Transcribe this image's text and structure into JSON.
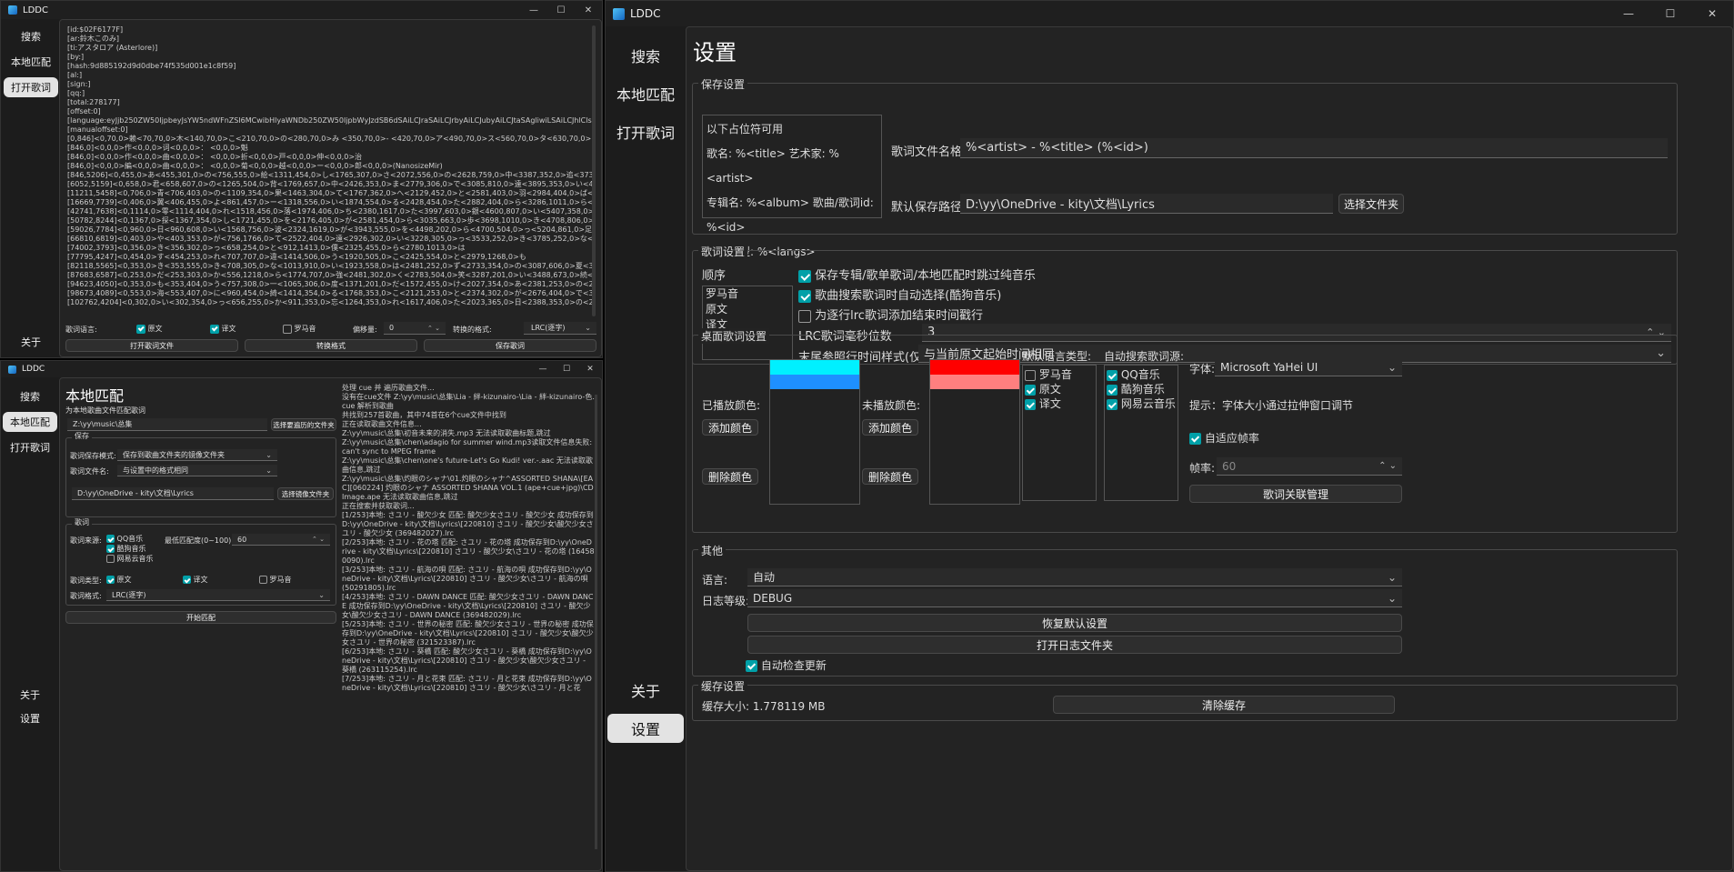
{
  "app": {
    "title": "LDDC",
    "min": "—",
    "max": "☐",
    "close": "✕"
  },
  "nav": {
    "search": "搜索",
    "local": "本地匹配",
    "open": "打开歌词",
    "about": "关于",
    "settings": "设置"
  },
  "lyrics_win": {
    "lines": [
      "[id:$02F6177F]",
      "[ar:鈴木このみ]",
      "[ti:アスタロア (Asterlore)]",
      "[by:]",
      "[hash:9d885192d9d0dbe74f535d001e1c8f59]",
      "[al:]",
      "[sign:]",
      "[qq:]",
      "[total:278177]",
      "[offset:0]",
      "[language:eyJjb250ZW50IjpbeyJsYW5ndWFnZSI6MCwibHlyaWNDb250ZW50IjpbWyJzdSB6dSAiLCJraSAiLCJrbyAiLCJubyAiLCJtaSAgliwiLSAiLCJhlClsInN1IlClsInRhIl",
      "[manualoffset:0]",
      "[0,846]<0,70,0>赖<70,70,0>木<140,70,0>こ<210,70,0>の<280,70,0>み <350,70,0>- <420,70,0>ア<490,70,0>ス<560,70,0>タ<630,70,0>ロ<700,70,0>ア<770,70",
      "[846,0]<0,0,0>作<0,0,0>词<0,0,0>： <0,0,0>魁",
      "[846,0]<0,0,0>作<0,0,0>曲<0,0,0>： <0,0,0>折<0,0,0>戸<0,0,0>伸<0,0,0>治",
      "[846,0]<0,0,0>編<0,0,0>曲<0,0,0>： <0,0,0>菊<0,0,0>越<0,0,0>ー<0,0,0>郎<0,0,0>(NanosizeMir)",
      "[846,5206]<0,455,0>あ<455,301,0>の<756,555,0>絵<1311,454,0>し<1765,307,0>さ<2072,556,0>の<2628,759,0>中<3387,352,0>追<3739,353,0>い<4092,305,(",
      "[6052,5159]<0,658,0>君<658,607,0>の<1265,504,0>背<1769,657,0>中<2426,353,0>ま<2779,306,0>で<3085,810,0>遠<3895,353,0>い<4248,354,0>け<4602,55",
      "[11211,5458]<0,706,0>青<706,403,0>の<1109,354,0>果<1463,304,0>て<1767,362,0>へ<2129,452,0>と<2581,403,0>羽<2984,404,0>ば<3388,352,0>た<3740,3",
      "[16669,7739]<0,406,0>翼<406,455,0>よ<861,457,0>ー<1318,556,0>い<1874,554,0>る<2428,454,0>た<2882,404,0>ら<3286,1011,0>ら<4297,3442,0>も",
      "[42741,7638]<0,1114,0>零<1114,404,0>れ<1518,456,0>落<1974,406,0>ち<2380,1617,0>た<3997,603,0>銀<4600,807,0>い<5407,358,0>事<5963,402,0>た",
      "[50782,8244]<0,1367,0>探<1367,354,0>し<1721,455,0>を<2176,405,0>が<2581,454,0>ら<3035,663,0>歩<3698,1010,0>き<4708,806,0>続<5514,270,0>け",
      "[59026,7784]<0,960,0>日<960,608,0>い<1568,756,0>波<2324,1619,0>が<3943,555,0>を<4498,202,0>ら<4700,504,0>っ<5204,861,0>足<6065,607,0>跡<6672,",
      "[66810,6819]<0,403,0>や<403,353,0>が<756,1766,0>て<2522,404,0>遠<2926,302,0>い<3228,305,0>っ<3533,252,0>き<3785,252,0>な<4037,409,0>ろ<4446,2",
      "[74002,3793]<0,356,0>き<356,302,0>っ<658,254,0>と<912,1413,0>僕<2325,455,0>ら<2780,1013,0>は",
      "[77795,4247]<0,454,0>す<454,253,0>れ<707,707,0>違<1414,506,0>う<1920,505,0>こ<2425,554,0>と<2979,1268,0>も",
      "[82118,5565]<0,353,0>き<353,555,0>き<708,305,0>な<1013,910,0>い<1923,558,0>は<2481,252,0>ず<2733,354,0>の<3087,606,0>夏<3693,455,0>に<4148,76",
      "[87683,6587]<0,253,0>だ<253,303,0>か<556,1218,0>ら<1774,707,0>強<2481,302,0>く<2783,504,0>笑<3287,201,0>い<3488,673,0>続<4161,353,0>け<4514,",
      "[94623,4050]<0,353,0>も<353,404,0>う<757,308,0>一<1065,306,0>度<1371,201,0>だ<1572,455,0>け<2027,354,0>あ<2381,253,0>の<2634,457,0>憧<3091,35",
      "[98673,4089]<0,553,0>海<553,407,0>に<960,454,0>綺<1414,354,0>る<1768,353,0>こ<2121,253,0>と<2374,302,0>が<2676,404,0>で<3080,302,0>き<3382,35",
      "[102762,4204]<0,302,0>い<302,354,0>っ<656,255,0>か<911,353,0>忘<1264,353,0>れ<1617,406,0>た<2023,365,0>日<2388,353,0>の<2741,352,0>終<3093,35"
    ],
    "bottom": {
      "lang_label": "歌词语言:",
      "orig": "原文",
      "trans": "译文",
      "roma": "罗马音",
      "offset_label": "偏移量:",
      "offset_value": "0",
      "convert_label": "转换的格式:",
      "convert_value": "LRC(逐字)",
      "open_btn": "打开歌词文件",
      "convert_btn": "转换格式",
      "save_btn": "保存歌词"
    }
  },
  "local_win": {
    "title": "本地匹配",
    "subtitle": "为本地歌曲文件匹配歌词",
    "dir": "Z:\\yy\\music\\总集",
    "dir_btn": "选择要遍历的文件夹",
    "save_group": "保存",
    "mode_label": "歌词保存模式:",
    "mode_value": "保存到歌曲文件夹的镜像文件夹",
    "name_label": "歌词文件名:",
    "name_value": "与设置中的格式相同",
    "mirror_path": "D:\\yy\\OneDrive - kity\\文档\\Lyrics",
    "mirror_btn": "选择镜像文件夹",
    "lyrics_group": "歌词",
    "source_label": "歌词来源:",
    "sources": [
      "QQ音乐",
      "酷狗音乐",
      "网易云音乐"
    ],
    "min_label": "最低匹配度(0~100):",
    "min_value": "60",
    "type_label": "歌词类型:",
    "orig": "原文",
    "trans": "译文",
    "roma": "罗马音",
    "fmt_label": "歌词格式:",
    "fmt_value": "LRC(逐字)",
    "start_btn": "开始匹配",
    "log": "处理 cue 并 遍历歌曲文件...\n没有在cue文件 Z:\\yy\\music\\总集\\Lia - 絆-kizunairo-\\Lia - 絆-kizunairo-色.cue 解析到歌曲\n共找到257首歌曲，其中74首在6个cue文件中找到\n正在读取歌曲文件信息...\nZ:\\yy\\music\\总集\\初音未来的消失.mp3 无法读取歌曲标题,跳过\nZ:\\yy\\music\\总集\\chen\\adagio for summer wind.mp3读取文件信息失败:can't sync to MPEG frame\nZ:\\yy\\music\\总集\\chen\\one's future-Let's Go Kudi! ver.-.aac 无法读取歌曲信息,跳过\nZ:\\yy\\music\\总集\\灼眼のシャナ\\01.灼眼のシャナ^ASSORTED SHANA\\[EAC][060224] 灼眼のシャナ ASSORTED SHANA VOL.1 (ape+cue+jpg)\\CDImage.ape 无法读取歌曲信息,跳过\n正在搜索并获取歌词...\n[1/253]本地: さユリ - 酸欠少女 匹配: 酸欠少女さユリ - 酸欠少女 成功保存到D:\\yy\\OneDrive - kity\\文档\\Lyrics\\[220810] さユリ - 酸欠少女\\酸欠少女さユリ - 酸欠少女 (369482027).lrc\n[2/253]本地: さユリ - 花の塔 匹配: さユリ - 花の塔 成功保存到D:\\yy\\OneDrive - kity\\文档\\Lyrics\\[220810] さユリ - 酸欠少女\\さユリ - 花の塔 (164580090).lrc\n[3/253]本地: さユリ - 航海の唄 匹配: さユリ - 航海の唄 成功保存到D:\\yy\\OneDrive - kity\\文档\\Lyrics\\[220810] さユリ - 酸欠少女\\さユリ - 航海の唄 (50291805).lrc\n[4/253]本地: さユリ - DAWN DANCE 匹配: 酸欠少女さユリ - DAWN DANCE 成功保存到D:\\yy\\OneDrive - kity\\文档\\Lyrics\\[220810] さユリ - 酸欠少女\\酸欠少女さユリ - DAWN DANCE (369482029).lrc\n[5/253]本地: さユリ - 世界の秘密 匹配: 酸欠少女さユリ - 世界の秘密 成功保存到D:\\yy\\OneDrive - kity\\文档\\Lyrics\\[220810] さユリ - 酸欠少女\\酸欠少女さユリ - 世界の秘密 (321523387).lrc\n[6/253]本地: さユリ - 葵橋 匹配: 酸欠少女さユリ - 葵橋 成功保存到D:\\yy\\OneDrive - kity\\文档\\Lyrics\\[220810] さユリ - 酸欠少女\\酸欠少女さユリ - 葵橋 (263115254).lrc\n[7/253]本地: さユリ - 月と花束 匹配: さユリ - 月と花束 成功保存到D:\\yy\\OneDrive - kity\\文档\\Lyrics\\[220810] さユリ - 酸欠少女\\さユリ - 月と花"
  },
  "settings": {
    "title": "设置",
    "save_group": "保存设置",
    "placeholder_lines": [
      "以下占位符可用",
      "歌名: %<title> 艺术家: %<artist>",
      "专辑名: %<album> 歌曲/歌词id: %<id>",
      "语言类型: %<langs>"
    ],
    "fname_label": "歌词文件名格式",
    "fname_value": "%<artist> - %<title> (%<id>)",
    "path_label": "默认保存路径",
    "path_value": "D:\\yy\\OneDrive - kity\\文档\\Lyrics",
    "path_btn": "选择文件夹",
    "lyrics_group": "歌词设置",
    "order_label": "顺序",
    "order": [
      "罗马音",
      "原文",
      "译文"
    ],
    "opt1": "保存专辑/歌单歌词/本地匹配时跳过纯音乐",
    "opt2": "歌曲搜索歌词时自动选择(酷狗音乐)",
    "opt3": "为逐行lrc歌词添加结束时间戳行",
    "ms_label": "LRC歌词毫秒位数",
    "ms_value": "3",
    "end_label": "末尾参照行时间样式(仅LRC):",
    "end_value": "与当前原文起始时间相同",
    "desktop_group": "桌面歌词设置",
    "played_label": "已播放颜色:",
    "unplayed_label": "未播放颜色:",
    "add_color": "添加颜色",
    "del_color": "删除颜色",
    "played_colors": [
      "#00f0ff",
      "#1e90ff"
    ],
    "unplayed_colors": [
      "#ff0000",
      "#ff7f7f"
    ],
    "lang_type_label": "默认语言类型:",
    "lang_types": [
      "罗马音",
      "原文",
      "译文"
    ],
    "auto_src_label": "自动搜索歌词源:",
    "auto_srcs": [
      "QQ音乐",
      "酷狗音乐",
      "网易云音乐"
    ],
    "font_label": "字体:",
    "font_value": "Microsoft YaHei UI",
    "hint": "提示：字体大小通过拉伸窗口调节",
    "auto_fps": "自适应帧率",
    "fps_label": "帧率:",
    "fps_value": "60",
    "assoc_btn": "歌词关联管理",
    "other_group": "其他",
    "lang_label": "语言:",
    "lang_value": "自动",
    "log_label": "日志等级:",
    "log_value": "DEBUG",
    "restore_btn": "恢复默认设置",
    "open_log_btn": "打开日志文件夹",
    "auto_update": "自动检查更新",
    "cache_group": "缓存设置",
    "cache_label": "缓存大小: 1.778119 MB",
    "clear_btn": "清除缓存"
  },
  "colors": {
    "accent": "#00a0a8"
  }
}
